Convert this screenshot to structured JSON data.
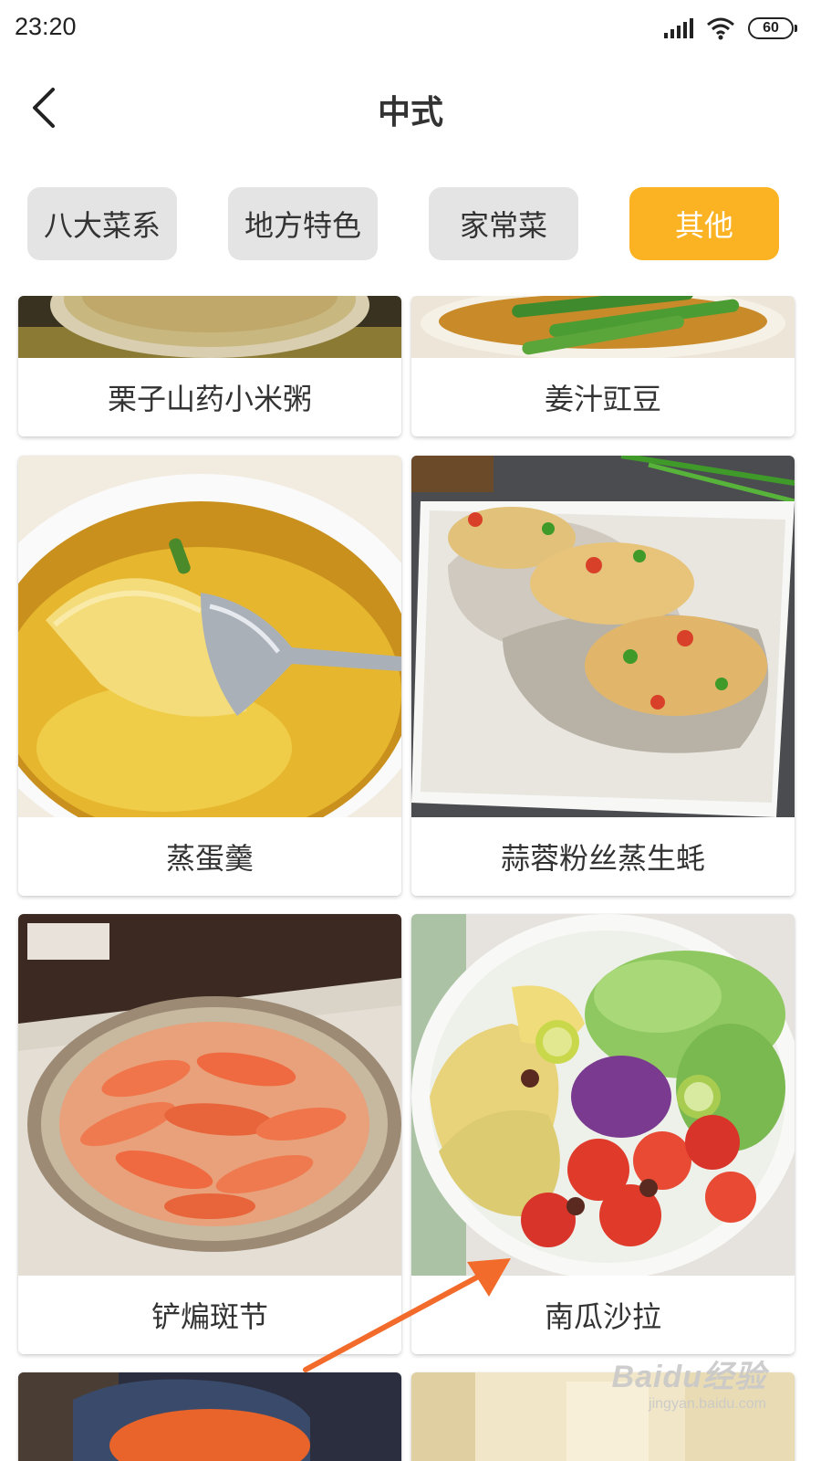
{
  "status_bar": {
    "time": "23:20",
    "battery": "60",
    "icons": [
      "signal-icon",
      "wifi-icon",
      "battery-icon"
    ]
  },
  "header": {
    "title": "中式",
    "back_icon": "chevron-left-icon"
  },
  "tabs": [
    {
      "label": "八大菜系",
      "active": false
    },
    {
      "label": "地方特色",
      "active": false
    },
    {
      "label": "家常菜",
      "active": false
    },
    {
      "label": "其他",
      "active": true
    }
  ],
  "recipes": [
    {
      "name": "栗子山药小米粥"
    },
    {
      "name": "姜汁豇豆"
    },
    {
      "name": "蒸蛋羹"
    },
    {
      "name": "蒜蓉粉丝蒸生蚝"
    },
    {
      "name": "铲煸斑节"
    },
    {
      "name": "南瓜沙拉"
    }
  ],
  "watermark": {
    "logo": "Baidu经验",
    "url": "jingyan.baidu.com"
  },
  "colors": {
    "accent": "#fbb324",
    "tab_inactive": "#e4e4e4",
    "arrow": "#f26b2a"
  }
}
